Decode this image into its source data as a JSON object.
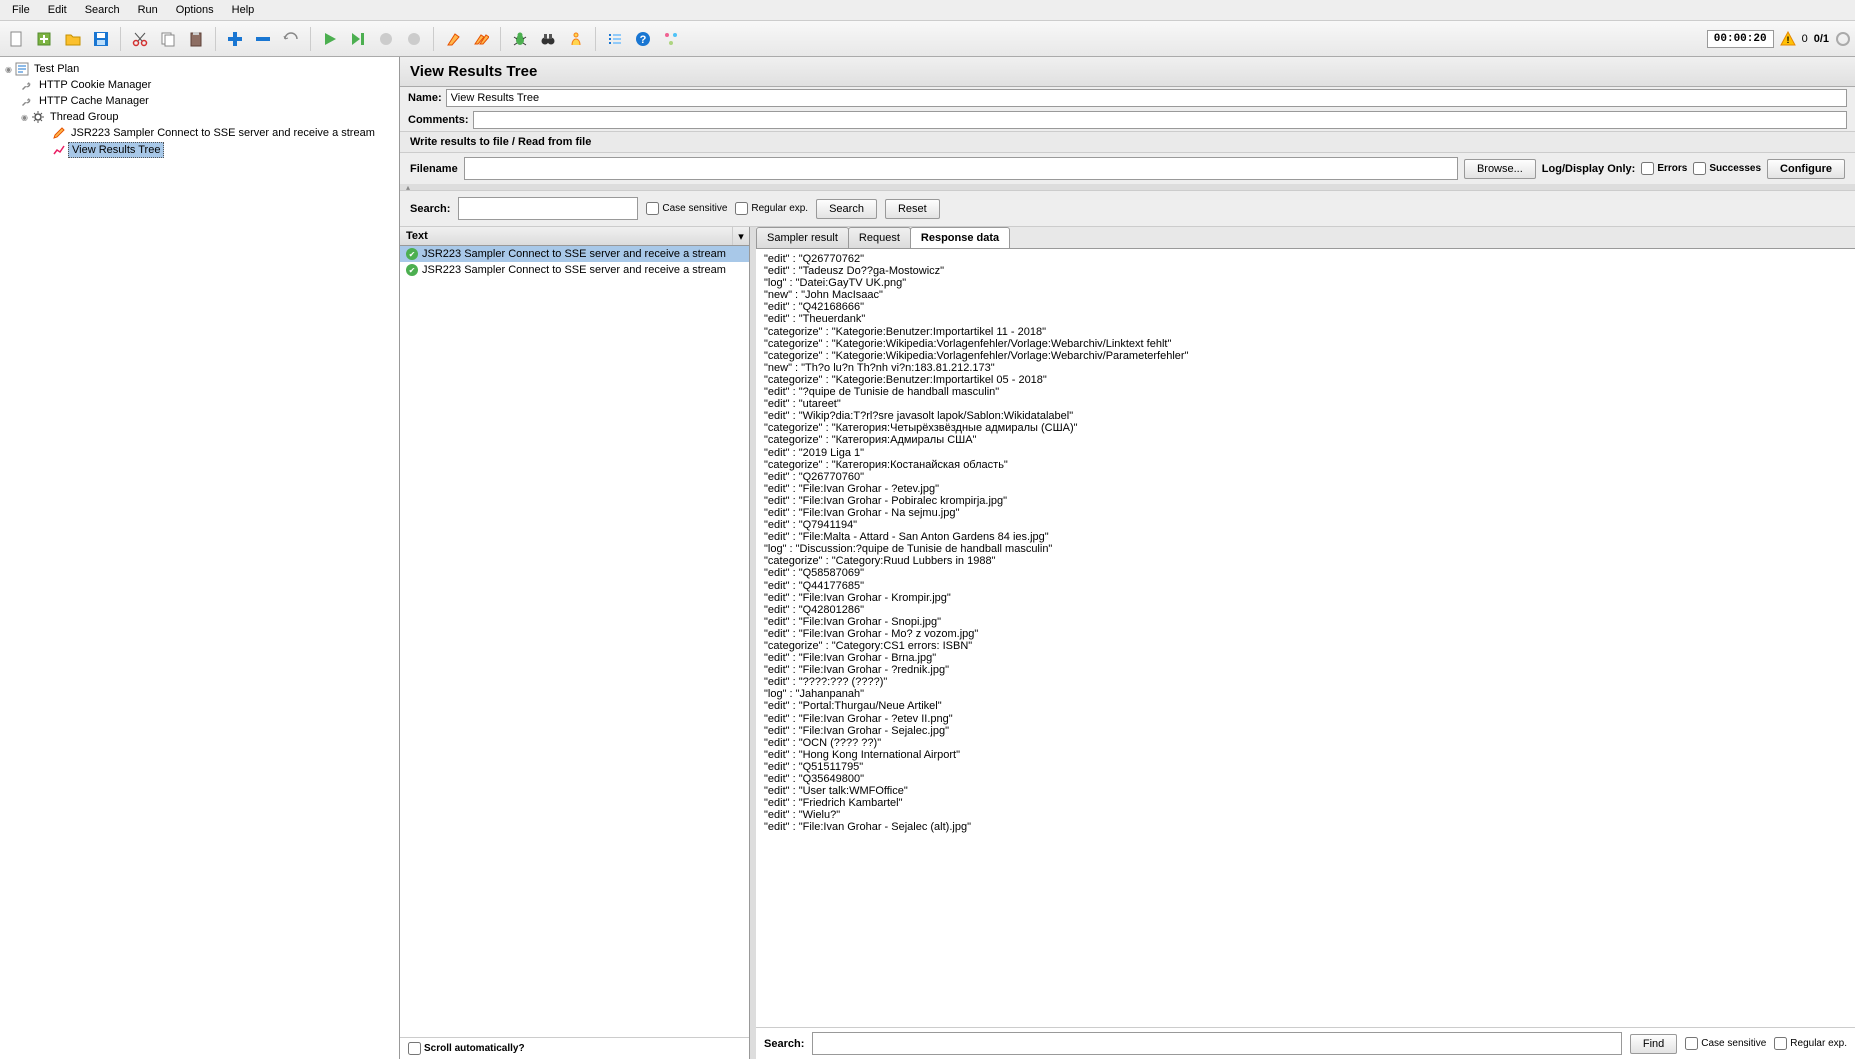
{
  "menu": [
    "File",
    "Edit",
    "Search",
    "Run",
    "Options",
    "Help"
  ],
  "timer": "00:00:20",
  "counter": "0/1",
  "zero": "0",
  "tree": {
    "root": "Test Plan",
    "items": [
      {
        "label": "HTTP Cookie Manager",
        "icon": "wrench"
      },
      {
        "label": "HTTP Cache Manager",
        "icon": "wrench"
      },
      {
        "label": "Thread Group",
        "icon": "gear",
        "children": [
          {
            "label": "JSR223 Sampler Connect to SSE server and receive a stream",
            "icon": "pencil"
          },
          {
            "label": "View Results Tree",
            "icon": "graph",
            "selected": true
          }
        ]
      }
    ]
  },
  "panel": {
    "title": "View Results Tree",
    "name_label": "Name:",
    "name_value": "View Results Tree",
    "comments_label": "Comments:",
    "section": "Write results to file / Read from file",
    "filename_label": "Filename",
    "browse": "Browse...",
    "logdisplay": "Log/Display Only:",
    "errors": "Errors",
    "successes": "Successes",
    "configure": "Configure"
  },
  "search": {
    "label": "Search:",
    "case": "Case sensitive",
    "regex": "Regular exp.",
    "search_btn": "Search",
    "reset_btn": "Reset"
  },
  "results": {
    "header": "Text",
    "items": [
      "JSR223 Sampler Connect to SSE server and receive a stream",
      "JSR223 Sampler Connect to SSE server and receive a stream"
    ],
    "scroll_auto": "Scroll automatically?"
  },
  "tabs": [
    "Sampler result",
    "Request",
    "Response data"
  ],
  "response": [
    "\"edit\" : \"Q26770762\"",
    "\"edit\" : \"Tadeusz Do??ga-Mostowicz\"",
    "\"log\" : \"Datei:GayTV UK.png\"",
    "\"new\" : \"John MacIsaac\"",
    "\"edit\" : \"Q42168666\"",
    "\"edit\" : \"Theuerdank\"",
    "\"categorize\" : \"Kategorie:Benutzer:Importartikel 11 - 2018\"",
    "\"categorize\" : \"Kategorie:Wikipedia:Vorlagenfehler/Vorlage:Webarchiv/Linktext fehlt\"",
    "\"categorize\" : \"Kategorie:Wikipedia:Vorlagenfehler/Vorlage:Webarchiv/Parameterfehler\"",
    "\"new\" : \"Th?o lu?n Th?nh vi?n:183.81.212.173\"",
    "\"categorize\" : \"Kategorie:Benutzer:Importartikel 05 - 2018\"",
    "\"edit\" : \"?quipe de Tunisie de handball masculin\"",
    "\"edit\" : \"utareet\"",
    "\"edit\" : \"Wikip?dia:T?rl?sre javasolt lapok/Sablon:Wikidatalabel\"",
    "\"categorize\" : \"Категория:Четырёхзвёздные адмиралы (США)\"",
    "\"categorize\" : \"Категория:Адмиралы США\"",
    "\"edit\" : \"2019 Liga 1\"",
    "\"categorize\" : \"Категория:Костанайская область\"",
    "\"edit\" : \"Q26770760\"",
    "\"edit\" : \"File:Ivan Grohar - ?etev.jpg\"",
    "\"edit\" : \"File:Ivan Grohar - Pobiralec krompirja.jpg\"",
    "\"edit\" : \"File:Ivan Grohar - Na sejmu.jpg\"",
    "\"edit\" : \"Q7941194\"",
    "\"edit\" : \"File:Malta - Attard - San Anton Gardens 84 ies.jpg\"",
    "\"log\" : \"Discussion:?quipe de Tunisie de handball masculin\"",
    "\"categorize\" : \"Category:Ruud Lubbers in 1988\"",
    "\"edit\" : \"Q58587069\"",
    "\"edit\" : \"Q44177685\"",
    "\"edit\" : \"File:Ivan Grohar - Krompir.jpg\"",
    "\"edit\" : \"Q42801286\"",
    "\"edit\" : \"File:Ivan Grohar - Snopi.jpg\"",
    "\"edit\" : \"File:Ivan Grohar - Mo? z vozom.jpg\"",
    "\"categorize\" : \"Category:CS1 errors: ISBN\"",
    "\"edit\" : \"File:Ivan Grohar - Brna.jpg\"",
    "\"edit\" : \"File:Ivan Grohar - ?rednik.jpg\"",
    "\"edit\" : \"????:??? (????)\"",
    "\"log\" : \"Jahanpanah\"",
    "\"edit\" : \"Portal:Thurgau/Neue Artikel\"",
    "\"edit\" : \"File:Ivan Grohar - ?etev II.png\"",
    "\"edit\" : \"File:Ivan Grohar - Sejalec.jpg\"",
    "\"edit\" : \"OCN (???? ??)\"",
    "\"edit\" : \"Hong Kong International Airport\"",
    "\"edit\" : \"Q51511795\"",
    "\"edit\" : \"Q35649800\"",
    "\"edit\" : \"User talk:WMFOffice\"",
    "\"edit\" : \"Friedrich Kambartel\"",
    "\"edit\" : \"Wielu?\"",
    "\"edit\" : \"File:Ivan Grohar - Sejalec (alt).jpg\""
  ],
  "bottom_search": {
    "label": "Search:",
    "find": "Find",
    "case": "Case sensitive",
    "regex": "Regular exp."
  }
}
